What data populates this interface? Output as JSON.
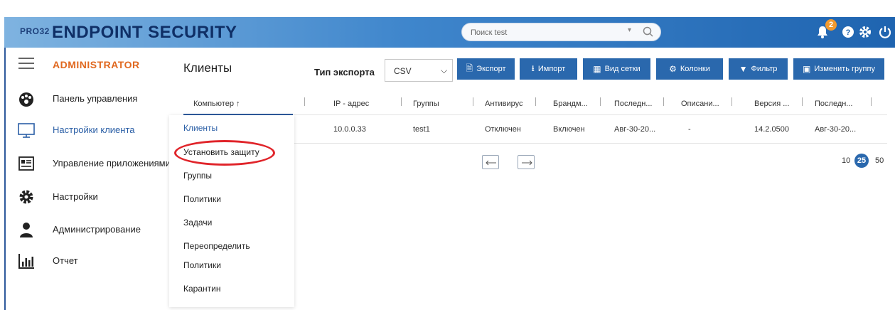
{
  "header": {
    "brand_small": "PRO32",
    "brand": "ENDPOINT SECURITY",
    "search_placeholder": "Поиск test",
    "search_dropdown": "▾",
    "notification_count": "2",
    "icons": [
      "bell-icon",
      "help-icon",
      "gear-icon",
      "power-icon"
    ]
  },
  "sidebar": {
    "title": "ADMINISTRATOR",
    "items": [
      {
        "label": "Панель управления",
        "icon": "dashboard-icon"
      },
      {
        "label": "Настройки клиента",
        "icon": "monitor-icon",
        "active": true
      },
      {
        "label": "Управление приложениями",
        "icon": "apps-icon"
      },
      {
        "label": "Настройки",
        "icon": "gear-icon"
      },
      {
        "label": "Администрирование",
        "icon": "user-icon"
      },
      {
        "label": "Отчет",
        "icon": "report-icon"
      }
    ]
  },
  "main": {
    "title": "Клиенты",
    "export_type_label": "Тип экспорта",
    "export_type_value": "CSV",
    "buttons": {
      "export": "Экспорт",
      "import": "Импорт",
      "grid": "Вид сетки",
      "columns": "Колонки",
      "filter": "Фильтр",
      "change_group": "Изменить группу"
    }
  },
  "table": {
    "columns": [
      "Компьютер ↑",
      "IP - адрес",
      "Группы",
      "Антивирус",
      "Брандм...",
      "Последн...",
      "Описани...",
      "Версия ...",
      "Последн..."
    ],
    "rows": [
      [
        "",
        "10.0.0.33",
        "test1",
        "Отключен",
        "Включен",
        "Авг-30-20...",
        "-",
        "14.2.0500",
        "Авг-30-20..."
      ]
    ]
  },
  "pagination": {
    "sizes": [
      "10",
      "25",
      "50"
    ],
    "selected": "25"
  },
  "submenu": {
    "items": [
      "Клиенты",
      "Установить защиту",
      "Группы",
      "Политики",
      "Задачи",
      "Переопределить",
      "Политики",
      "Карантин"
    ]
  },
  "colors": {
    "accent": "#2a68ad",
    "admin_title": "#e0681f",
    "highlight": "#e0242a",
    "badge": "#f29a2e"
  }
}
